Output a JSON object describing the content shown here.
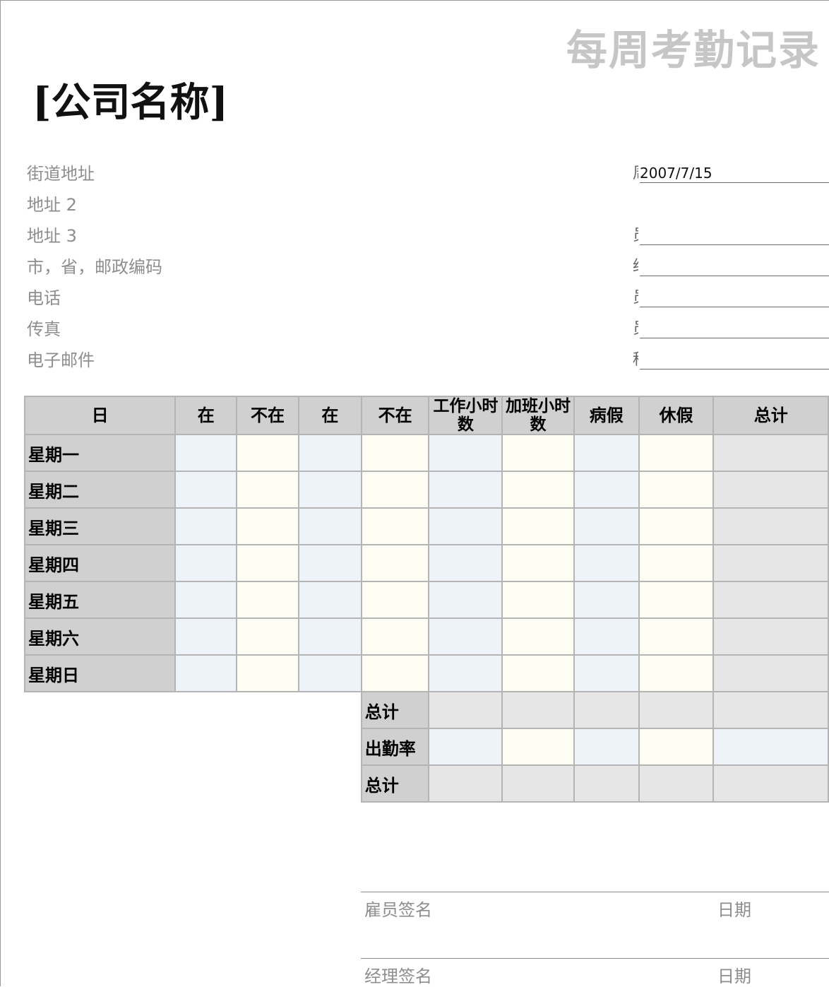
{
  "document_title": "每周考勤记录",
  "company_name": "[公司名称]",
  "address_lines": [
    "街道地址",
    "地址 2",
    "地址 3",
    "市，省，邮政编码",
    "电话",
    "传真",
    "电子邮件"
  ],
  "info_fields": [
    {
      "label": "周",
      "value": "2007/7/15"
    },
    {
      "label": "",
      "value": ""
    },
    {
      "label": "员",
      "value": ""
    },
    {
      "label": "经",
      "value": ""
    },
    {
      "label": "员",
      "value": ""
    },
    {
      "label": "员",
      "value": ""
    },
    {
      "label": "种",
      "value": ""
    }
  ],
  "table": {
    "headers": [
      "日",
      "在",
      "不在",
      "在",
      "不在",
      "工作小时数",
      "加班小时数",
      "病假",
      "休假",
      "总计"
    ],
    "days": [
      "星期一",
      "星期二",
      "星期三",
      "星期四",
      "星期五",
      "星期六",
      "星期日"
    ],
    "summary_rows": [
      "总计",
      "出勤率",
      "总计"
    ]
  },
  "signatures": {
    "employee": "雇员签名",
    "manager": "经理签名",
    "date": "日期"
  },
  "colors": {
    "header_bg": "#d0d0d0",
    "cell_blue": "#eef3f9",
    "cell_cream": "#fdfdf3",
    "cell_gray": "#e6e6e6",
    "muted_text": "#8e8e8e"
  }
}
